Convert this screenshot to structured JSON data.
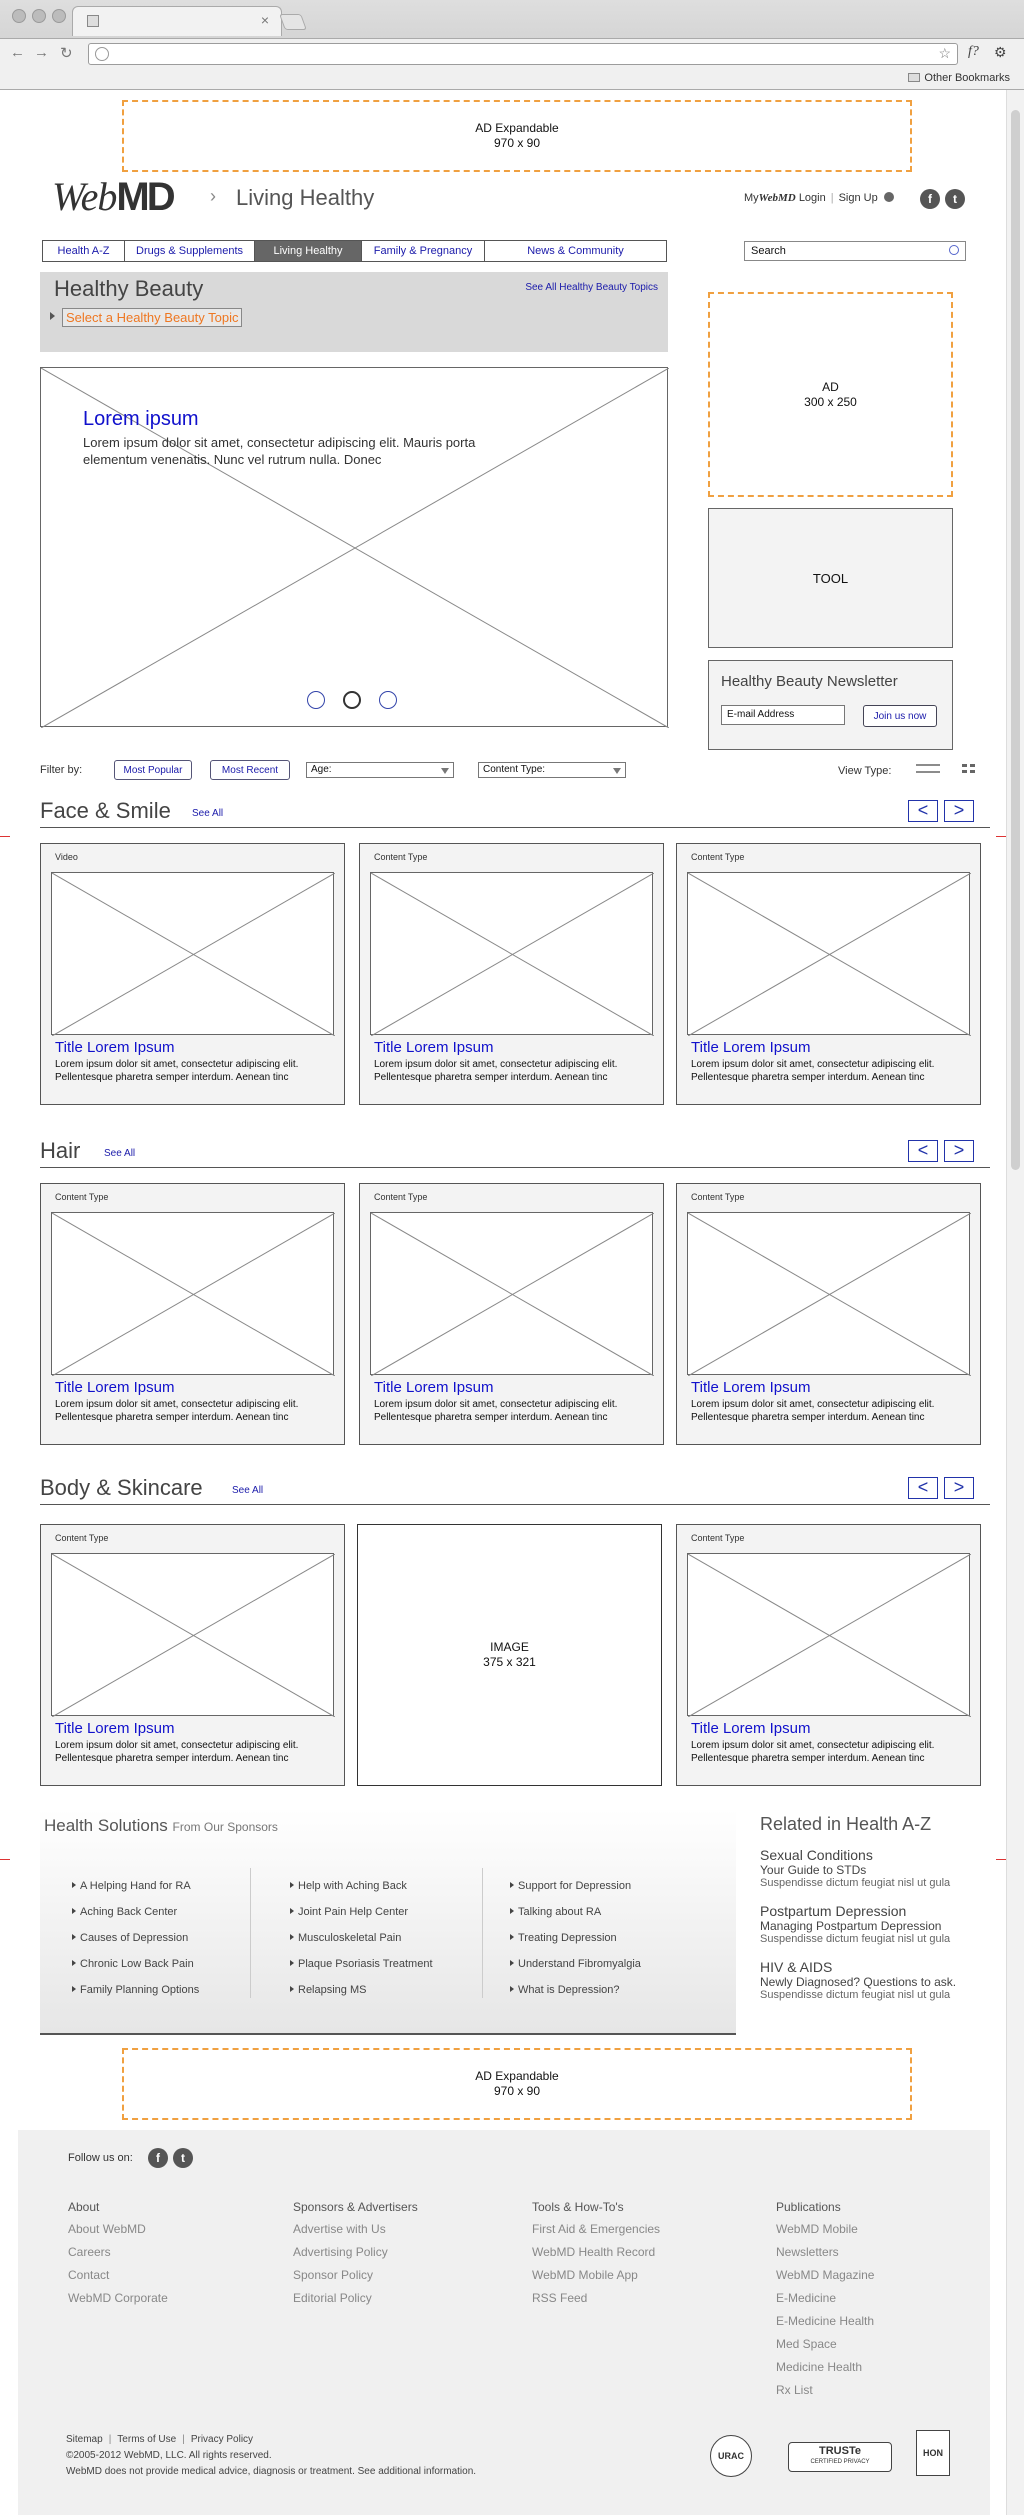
{
  "browser": {
    "bookmarks_label": "Other Bookmarks"
  },
  "ads": {
    "top": {
      "line1": "AD Expandable",
      "line2": "970 x 90"
    },
    "right": {
      "line1": "AD",
      "line2": "300 x 250"
    },
    "bottom": {
      "line1": "AD Expandable",
      "line2": "970 x 90"
    }
  },
  "header": {
    "logo_web": "Web",
    "logo_md": "MD",
    "crumb_sep": "›",
    "crumb": "Living Healthy",
    "my_prefix": "My",
    "my_logo": "WebMD",
    "login": "Login",
    "signup": "Sign Up"
  },
  "nav": {
    "items": [
      "Health A-Z",
      "Drugs & Supplements",
      "Living Healthy",
      "Family & Pregnancy",
      "News & Community"
    ],
    "active": "Living Healthy",
    "search_placeholder": "Search"
  },
  "topic": {
    "title": "Healthy Beauty",
    "see_all": "See All Healthy Beauty Topics",
    "select": "Select a Healthy Beauty Topic"
  },
  "hero": {
    "title": "Lorem ipsum",
    "body": "Lorem ipsum dolor sit amet, consectetur adipiscing elit. Mauris porta elementum venenatis. Nunc vel rutrum nulla. Donec",
    "active_dot": 2
  },
  "tool": {
    "label": "TOOL"
  },
  "newsletter": {
    "title": "Healthy Beauty Newsletter",
    "email_placeholder": "E-mail Address",
    "button": "Join us now"
  },
  "filter": {
    "label": "Filter by:",
    "popular": "Most Popular",
    "recent": "Most Recent",
    "age": "Age:",
    "content_type": "Content Type:",
    "view_type": "View Type:"
  },
  "sections": [
    {
      "title": "Face & Smile",
      "see_all": "See All",
      "cards": [
        {
          "type": "Video",
          "title": "Title Lorem Ipsum",
          "desc": "Lorem ipsum dolor sit amet, consectetur adipiscing elit. Pellentesque pharetra semper interdum. Aenean tinc"
        },
        {
          "type": "Content Type",
          "title": "Title Lorem Ipsum",
          "desc": "Lorem ipsum dolor sit amet, consectetur adipiscing elit. Pellentesque pharetra semper interdum. Aenean tinc"
        },
        {
          "type": "Content Type",
          "title": "Title Lorem Ipsum",
          "desc": "Lorem ipsum dolor sit amet, consectetur adipiscing elit. Pellentesque pharetra semper interdum. Aenean tinc"
        }
      ]
    },
    {
      "title": "Hair",
      "see_all": "See All",
      "cards": [
        {
          "type": "Content Type",
          "title": "Title Lorem Ipsum",
          "desc": "Lorem ipsum dolor sit amet, consectetur adipiscing elit. Pellentesque pharetra semper interdum. Aenean tinc"
        },
        {
          "type": "Content Type",
          "title": "Title Lorem Ipsum",
          "desc": "Lorem ipsum dolor sit amet, consectetur adipiscing elit. Pellentesque pharetra semper interdum. Aenean tinc"
        },
        {
          "type": "Content Type",
          "title": "Title Lorem Ipsum",
          "desc": "Lorem ipsum dolor sit amet, consectetur adipiscing elit. Pellentesque pharetra semper interdum. Aenean tinc"
        }
      ]
    },
    {
      "title": "Body & Skincare",
      "see_all": "See All",
      "cards": [
        {
          "type": "Content Type",
          "title": "Title Lorem Ipsum",
          "desc": "Lorem ipsum dolor sit amet, consectetur adipiscing elit. Pellentesque pharetra semper interdum. Aenean tinc"
        },
        {
          "image_line1": "IMAGE",
          "image_line2": "375 x 321"
        },
        {
          "type": "Content Type",
          "title": "Title Lorem Ipsum",
          "desc": "Lorem ipsum dolor sit amet, consectetur adipiscing elit. Pellentesque pharetra semper interdum. Aenean tinc"
        }
      ]
    }
  ],
  "pager": {
    "prev": "<",
    "next": ">"
  },
  "health_solutions": {
    "title": "Health Solutions",
    "subtitle": "From Our Sponsors",
    "cols": [
      [
        "A Helping Hand for RA",
        "Aching Back Center",
        "Causes of Depression",
        "Chronic Low Back Pain",
        "Family Planning Options"
      ],
      [
        "Help with Aching Back",
        "Joint Pain Help Center",
        "Musculoskeletal Pain",
        "Plaque Psoriasis Treatment",
        "Relapsing MS"
      ],
      [
        "Support for Depression",
        "Talking about RA",
        "Treating Depression",
        "Understand Fibromyalgia",
        "What is Depression?"
      ]
    ]
  },
  "related": {
    "title": "Related in Health A-Z",
    "items": [
      {
        "title": "Sexual Conditions",
        "sub": "Your Guide to STDs",
        "desc": "Suspendisse dictum feugiat nisl ut gula"
      },
      {
        "title": "Postpartum Depression",
        "sub": "Managing Postpartum Depression",
        "desc": "Suspendisse dictum feugiat nisl ut gula"
      },
      {
        "title": "HIV & AIDS",
        "sub": "Newly Diagnosed? Questions to ask.",
        "desc": "Suspendisse dictum feugiat nisl ut gula"
      }
    ]
  },
  "footer": {
    "follow": "Follow us on:",
    "cols": [
      {
        "head": "About",
        "links": [
          "About WebMD",
          "Careers",
          "Contact",
          "WebMD Corporate"
        ]
      },
      {
        "head": "Sponsors & Advertisers",
        "links": [
          "Advertise with Us",
          "Advertising Policy",
          "Sponsor Policy",
          "Editorial Policy"
        ]
      },
      {
        "head": "Tools & How-To's",
        "links": [
          "First Aid & Emergencies",
          "WebMD Health Record",
          "WebMD Mobile App",
          "RSS Feed"
        ]
      },
      {
        "head": "Publications",
        "links": [
          "WebMD Mobile",
          "Newsletters",
          "WebMD Magazine",
          "E-Medicine",
          "E-Medicine Health",
          "Med Space",
          "Medicine Health",
          "Rx List"
        ]
      }
    ],
    "legal_links": [
      "Sitemap",
      "Terms of Use",
      "Privacy Policy"
    ],
    "copyright": "©2005-2012 WebMD, LLC. All rights reserved.",
    "disclaimer": "WebMD does not provide medical advice, diagnosis or treatment. See additional information.",
    "seals": {
      "urac": "URAC",
      "truste": "TRUSTe",
      "truste_sub": "CERTIFIED PRIVACY",
      "hon": "HON"
    }
  }
}
